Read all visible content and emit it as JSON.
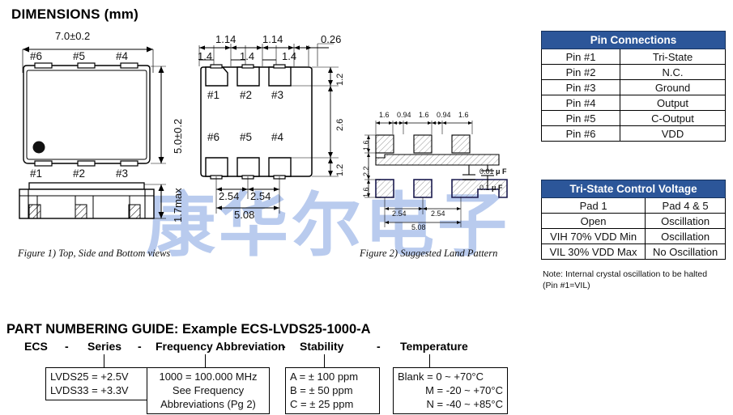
{
  "page": {
    "dimensions_title": "DIMENSIONS (mm)",
    "watermark": "康华尔电子"
  },
  "figure1": {
    "caption": "Figure 1) Top, Side and Bottom  views",
    "width": "7.0±0.2",
    "height": "5.0±0.2",
    "thickness": "1.7max",
    "top_pins": [
      "#6",
      "#5",
      "#4"
    ],
    "bottom_pins": [
      "#1",
      "#2",
      "#3"
    ]
  },
  "figure1b": {
    "top_dims": [
      "1.14",
      "1.14"
    ],
    "pad_widths": [
      "1.4",
      "1.4",
      "1.4"
    ],
    "edge_dim": "0.26",
    "right_dims": [
      "1.2",
      "2.6",
      "1.2"
    ],
    "bottom_dims": [
      "2.54",
      "2.54"
    ],
    "overall_dim": "5.08",
    "upper_pins": [
      "#1",
      "#2",
      "#3"
    ],
    "lower_pins": [
      "#6",
      "#5",
      "#4"
    ]
  },
  "figure2": {
    "caption": "Figure 2) Suggested Land Pattern",
    "top_dims": [
      "1.6",
      "0.94",
      "1.6",
      "0.94",
      "1.6"
    ],
    "left_dims": [
      "1.6",
      "2.2",
      "1.6"
    ],
    "bottom_dims": [
      "2.54",
      "2.54"
    ],
    "overall_dim": "5.08",
    "cap1": "0.01",
    "cap1_unit": "μ F",
    "cap2": "0.1",
    "cap2_unit": "μ F"
  },
  "pin_table": {
    "header": "Pin Connections",
    "rows": [
      {
        "pin": "Pin #1",
        "fn": "Tri-State"
      },
      {
        "pin": "Pin #2",
        "fn": "N.C."
      },
      {
        "pin": "Pin #3",
        "fn": "Ground"
      },
      {
        "pin": "Pin #4",
        "fn": "Output"
      },
      {
        "pin": "Pin #5",
        "fn": "C-Output"
      },
      {
        "pin": "Pin #6",
        "fn": "VDD"
      }
    ]
  },
  "tristate_table": {
    "header": "Tri-State Control Voltage",
    "col1": "Pad 1",
    "col2": "Pad 4 & 5",
    "rows": [
      {
        "pad1": "Open",
        "pad45": "Oscillation"
      },
      {
        "pad1": "VIH 70% VDD Min",
        "pad45": "Oscillation"
      },
      {
        "pad1": "VIL 30% VDD Max",
        "pad45": "No Oscillation"
      }
    ],
    "note_line1": "Note:  Internal crystal oscillation to be halted",
    "note_line2": "(Pin #1=VIL)"
  },
  "part_numbering": {
    "title": "PART NUMBERING GUIDE:  Example ECS-LVDS25-1000-A",
    "fields": [
      {
        "label": "ECS"
      },
      {
        "label": "Series"
      },
      {
        "label": "Frequency Abbreviation"
      },
      {
        "label": "Stability"
      },
      {
        "label": "Temperature"
      }
    ],
    "dash": "-",
    "series_box": [
      "LVDS25 = +2.5V",
      "LVDS33 = +3.3V"
    ],
    "freq_box": [
      "1000 = 100.000 MHz",
      "See Frequency",
      "Abbreviations (Pg 2)"
    ],
    "stability_box": [
      "A = ± 100 ppm",
      "B = ± 50 ppm",
      "C = ± 25 ppm"
    ],
    "temp_box": [
      "Blank =    0 ~ +70°C",
      "M = -20 ~ +70°C",
      "N = -40 ~ +85°C"
    ]
  },
  "colors": {
    "table_header": "#2c5699",
    "watermark": "#b9cbee"
  }
}
